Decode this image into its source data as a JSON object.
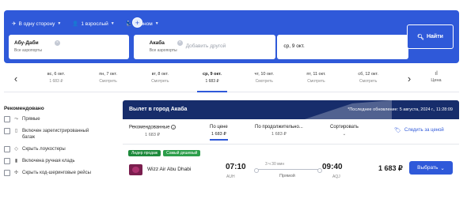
{
  "search": {
    "options": {
      "trip_type": "В одну сторону",
      "passengers": "1 взрослый",
      "cabin": "Эконом"
    },
    "from": {
      "city": "Абу-Даби",
      "sub": "Все аэропорты"
    },
    "to": {
      "city": "Акаба",
      "sub": "Все аэропорты",
      "add_other": "Добавить другой"
    },
    "date": "ср, 9 окт.",
    "find_label": "Найти",
    "swap_glyph": "+"
  },
  "date_strip": {
    "days": [
      {
        "date": "вс, 6 окт.",
        "price": "1 683 ₽"
      },
      {
        "date": "пн, 7 окт.",
        "price": "Смотреть"
      },
      {
        "date": "вт, 8 окт.",
        "price": "Смотреть"
      },
      {
        "date": "ср, 9 окт.",
        "price": "1 683 ₽"
      },
      {
        "date": "чт, 10 окт.",
        "price": "Смотреть"
      },
      {
        "date": "пт, 11 окт.",
        "price": "Смотреть"
      },
      {
        "date": "сб, 12 окт.",
        "price": "Смотреть"
      }
    ],
    "active_index": 3,
    "price_label": "Цена"
  },
  "filters": {
    "title": "Рекомендовано",
    "items": [
      {
        "label": "Прямые",
        "icon": "direct-route-icon"
      },
      {
        "label": "Включен зарегистрированный багаж",
        "icon": "baggage-icon"
      },
      {
        "label": "Скрыть лоукостеры",
        "icon": "tag-icon"
      },
      {
        "label": "Включена ручная кладь",
        "icon": "carry-on-icon"
      },
      {
        "label": "Скрыть код-шеринговые рейсы",
        "icon": "codeshare-icon"
      }
    ]
  },
  "results": {
    "title": "Вылет в город Акаба",
    "updated": "*Последнее обновление: 5 августа, 2024 г., 11:28:09",
    "sort": [
      {
        "label": "Рекомендованные",
        "value": "1 683 ₽",
        "active": false
      },
      {
        "label": "По цене",
        "value": "1 683 ₽",
        "active": true
      },
      {
        "label": "По продолжительно...",
        "value": "1 683 ₽",
        "active": false
      },
      {
        "label": "Сортировать",
        "value": "",
        "active": false
      }
    ],
    "follow_label": "Следить за ценой",
    "flight": {
      "badges": [
        "Лидер продаж",
        "Самый дешевый"
      ],
      "airline": "Wizz Air Abu Dhabi",
      "dep_time": "07:10",
      "dep_code": "AUH",
      "duration": "3 ч 30 мин",
      "stops": "Прямой",
      "arr_time": "09:40",
      "arr_code": "AQJ",
      "price": "1 683 ₽",
      "choose_label": "Выбрать"
    }
  },
  "colors": {
    "accent": "#2f59d9",
    "header_dark": "#172d6b",
    "badge_green": "#1e8a3c"
  }
}
